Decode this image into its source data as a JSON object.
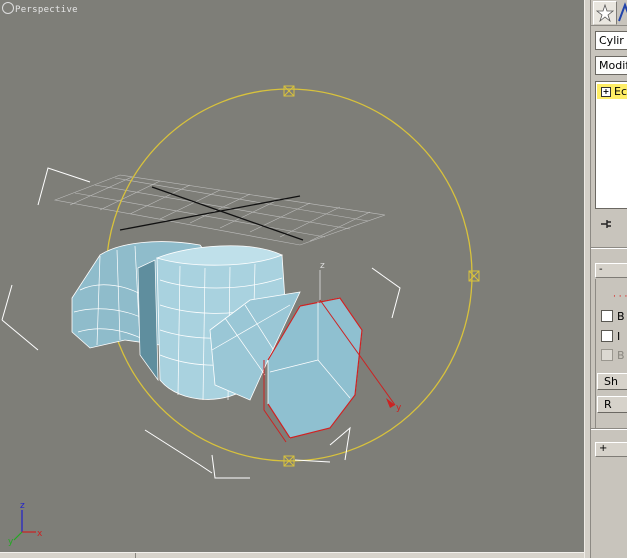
{
  "viewport": {
    "label": "Perspective",
    "axis_labels": {
      "x": "x",
      "y": "y",
      "z": "z"
    },
    "colors": {
      "background": "#7e7e78",
      "gizmo_circle": "#d8c23c",
      "selection_edge": "#cc2222",
      "mesh_face": "#9ecad8",
      "mesh_wire": "#ffffff",
      "grid": "#c9c9c9",
      "axis_x": "#cc2222",
      "axis_y": "#22aa22",
      "axis_z": "#2222cc"
    }
  },
  "panel": {
    "tabs": {
      "create_icon": "create-icon",
      "modify_icon": "modify-icon"
    },
    "object_name": "Cylir",
    "modifier_list": "Modifi",
    "stack_item_label": "Ec",
    "rollout1_label": "-",
    "checkbox1_label": "B",
    "checkbox2_label": "I",
    "checkbox3_label": "B",
    "button1_label": "Sh",
    "button2_label": "R",
    "rollout2_label": "+",
    "selection_dots": "· · ·"
  }
}
